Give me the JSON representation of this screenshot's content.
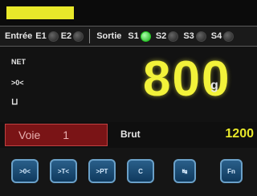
{
  "io": {
    "entree_label": "Entrée",
    "inputs": [
      {
        "label": "E1",
        "on": false
      },
      {
        "label": "E2",
        "on": false
      }
    ],
    "sortie_label": "Sortie",
    "outputs": [
      {
        "label": "S1",
        "on": true
      },
      {
        "label": "S2",
        "on": false
      },
      {
        "label": "S3",
        "on": false
      },
      {
        "label": "S4",
        "on": false
      }
    ]
  },
  "indicators": {
    "net": "NET",
    "zero": ">0<",
    "stable": "⊔"
  },
  "weight": {
    "value": "800",
    "unit": "g"
  },
  "channel": {
    "label": "Voie",
    "number": "1"
  },
  "gross": {
    "label": "Brut",
    "value": "1200"
  },
  "buttons": [
    {
      "label": ">0<"
    },
    {
      "label": ">T<"
    },
    {
      "label": ">PT"
    },
    {
      "label": "C"
    },
    {
      "label": "↹"
    },
    {
      "label": "Fn"
    }
  ],
  "colors": {
    "accent": "#e8e82a",
    "channel_bg": "#7a1416",
    "button_bg": "#1f4d73",
    "led_on": "#1fae1f"
  }
}
